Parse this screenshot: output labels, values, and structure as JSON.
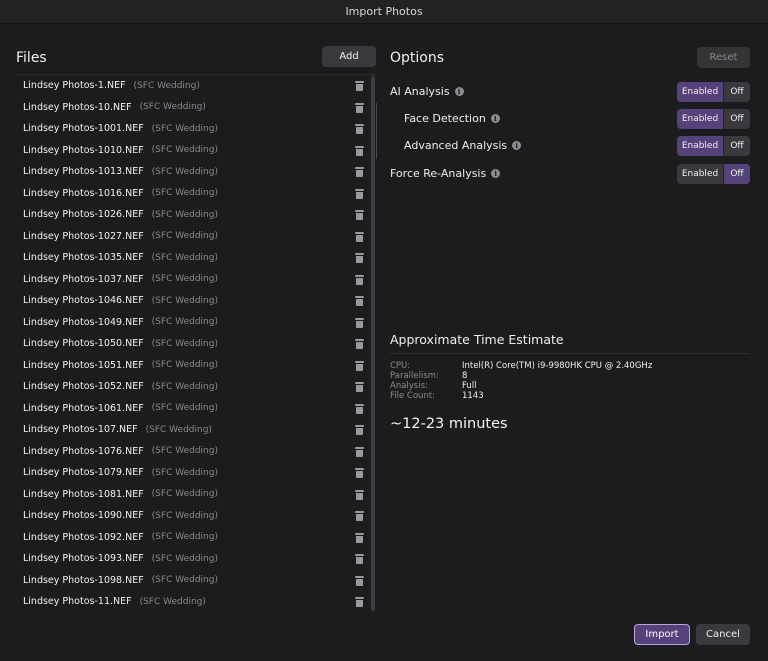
{
  "window": {
    "title": "Import Photos"
  },
  "files": {
    "title": "Files",
    "add_label": "Add",
    "items": [
      {
        "name": "Lindsey Photos-1.NEF",
        "tag": "(SFC Wedding)"
      },
      {
        "name": "Lindsey Photos-10.NEF",
        "tag": "(SFC Wedding)"
      },
      {
        "name": "Lindsey Photos-1001.NEF",
        "tag": "(SFC Wedding)"
      },
      {
        "name": "Lindsey Photos-1010.NEF",
        "tag": "(SFC Wedding)"
      },
      {
        "name": "Lindsey Photos-1013.NEF",
        "tag": "(SFC Wedding)"
      },
      {
        "name": "Lindsey Photos-1016.NEF",
        "tag": "(SFC Wedding)"
      },
      {
        "name": "Lindsey Photos-1026.NEF",
        "tag": "(SFC Wedding)"
      },
      {
        "name": "Lindsey Photos-1027.NEF",
        "tag": "(SFC Wedding)"
      },
      {
        "name": "Lindsey Photos-1035.NEF",
        "tag": "(SFC Wedding)"
      },
      {
        "name": "Lindsey Photos-1037.NEF",
        "tag": "(SFC Wedding)"
      },
      {
        "name": "Lindsey Photos-1046.NEF",
        "tag": "(SFC Wedding)"
      },
      {
        "name": "Lindsey Photos-1049.NEF",
        "tag": "(SFC Wedding)"
      },
      {
        "name": "Lindsey Photos-1050.NEF",
        "tag": "(SFC Wedding)"
      },
      {
        "name": "Lindsey Photos-1051.NEF",
        "tag": "(SFC Wedding)"
      },
      {
        "name": "Lindsey Photos-1052.NEF",
        "tag": "(SFC Wedding)"
      },
      {
        "name": "Lindsey Photos-1061.NEF",
        "tag": "(SFC Wedding)"
      },
      {
        "name": "Lindsey Photos-107.NEF",
        "tag": "(SFC Wedding)"
      },
      {
        "name": "Lindsey Photos-1076.NEF",
        "tag": "(SFC Wedding)"
      },
      {
        "name": "Lindsey Photos-1079.NEF",
        "tag": "(SFC Wedding)"
      },
      {
        "name": "Lindsey Photos-1081.NEF",
        "tag": "(SFC Wedding)"
      },
      {
        "name": "Lindsey Photos-1090.NEF",
        "tag": "(SFC Wedding)"
      },
      {
        "name": "Lindsey Photos-1092.NEF",
        "tag": "(SFC Wedding)"
      },
      {
        "name": "Lindsey Photos-1093.NEF",
        "tag": "(SFC Wedding)"
      },
      {
        "name": "Lindsey Photos-1098.NEF",
        "tag": "(SFC Wedding)"
      },
      {
        "name": "Lindsey Photos-11.NEF",
        "tag": "(SFC Wedding)"
      }
    ]
  },
  "options": {
    "title": "Options",
    "reset_label": "Reset",
    "items": [
      {
        "label": "AI Analysis",
        "indent": false,
        "enabled_label": "Enabled",
        "off_label": "Off",
        "value": "Enabled"
      },
      {
        "label": "Face Detection",
        "indent": true,
        "enabled_label": "Enabled",
        "off_label": "Off",
        "value": "Enabled"
      },
      {
        "label": "Advanced Analysis",
        "indent": true,
        "enabled_label": "Enabled",
        "off_label": "Off",
        "value": "Enabled"
      },
      {
        "label": "Force Re-Analysis",
        "indent": false,
        "enabled_label": "Enabled",
        "off_label": "Off",
        "value": "Off"
      }
    ]
  },
  "estimate": {
    "title": "Approximate Time Estimate",
    "stats": [
      {
        "key": "CPU:",
        "value": "Intel(R) Core(TM) i9-9980HK CPU @ 2.40GHz"
      },
      {
        "key": "Parallelism:",
        "value": "8"
      },
      {
        "key": "Analysis:",
        "value": "Full"
      },
      {
        "key": "File Count:",
        "value": "1143"
      }
    ],
    "duration": "~12-23 minutes"
  },
  "footer": {
    "import_label": "Import",
    "cancel_label": "Cancel"
  },
  "colors": {
    "accent": "#56427a",
    "background": "#1c1c1e",
    "button": "#3a3a3e"
  }
}
